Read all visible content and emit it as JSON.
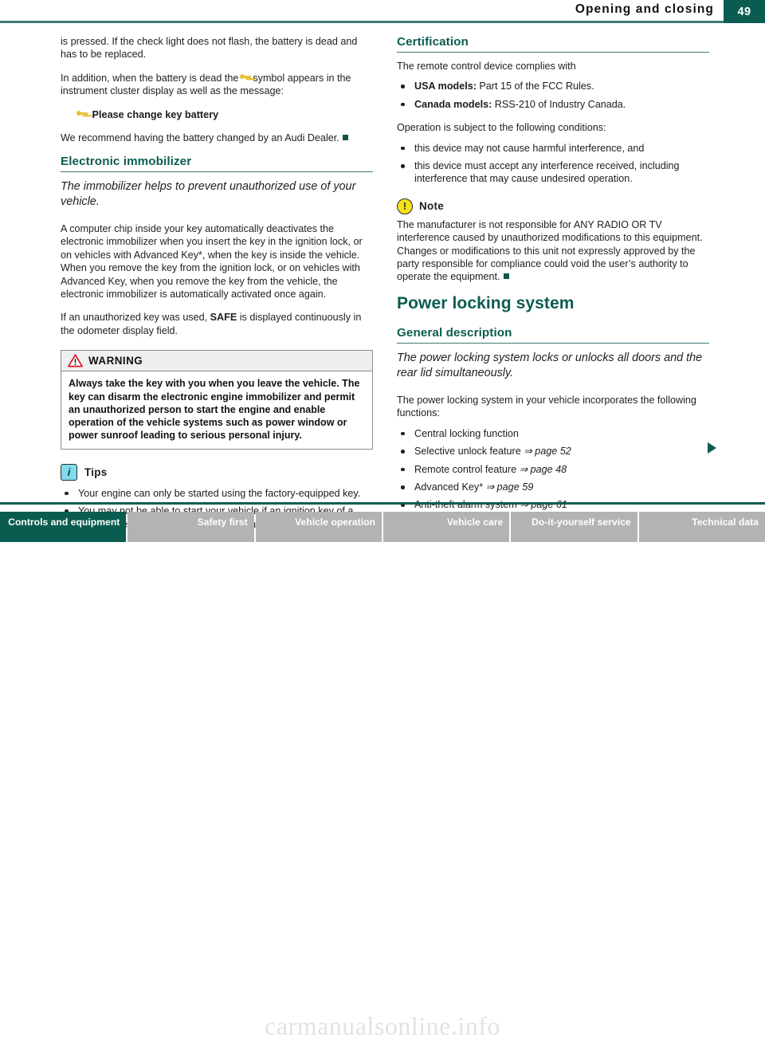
{
  "header": {
    "title": "Opening and closing",
    "page_number": "49"
  },
  "left_column": {
    "para_1": "is pressed. If the check light does not flash, the battery is dead and has to be replaced.",
    "para_2_before": "In addition, when the battery is dead the",
    "para_2_after": "symbol appears in the instrument cluster display as well as the message:",
    "message_line": "Please change key battery",
    "para_3": "We recommend having the battery changed by an Audi Dealer.",
    "section_heading": "Electronic immobilizer",
    "lead": "The immobilizer helps to prevent unauthorized use of your vehicle.",
    "para_4": "A computer chip inside your key automatically deactivates the electronic immobilizer when you insert the key in the ignition lock, or on vehicles with Advanced Key*, when the key is inside the vehicle. When you remove the key from the ignition lock, or on vehicles with Advanced Key, when you remove the key from the vehicle, the electronic immobilizer is automatically activated once again.",
    "para_5_a": "If an unauthorized key was used,",
    "para_5_bold": "SAFE",
    "para_5_b": "is displayed continuously in the odometer display field.",
    "warning": {
      "label": "WARNING",
      "body": "Always take the key with you when you leave the vehicle. The key can disarm the electronic engine immobilizer and permit an unauthorized person to start the engine and enable operation of the vehicle systems such as power window or power sunroof leading to serious personal injury."
    },
    "tips": {
      "label": "Tips",
      "icon_letter": "i",
      "items": [
        "Your engine can only be started using the factory-equipped key.",
        "You may not be able to start your vehicle if an ignition key of a different vehicle make is also located on your set of keys."
      ]
    }
  },
  "right_column": {
    "certification_heading": "Certification",
    "para_1": "The remote control device complies with",
    "compliance": [
      {
        "bold": "USA models:",
        "rest": "Part 15 of the FCC Rules."
      },
      {
        "bold": "Canada models:",
        "rest": "RSS-210 of Industry Canada."
      }
    ],
    "para_2": "Operation is subject to the following conditions:",
    "conditions": [
      "this device may not cause harmful interference, and",
      "this device must accept any interference received, including interference that may cause undesired operation."
    ],
    "note": {
      "label": "Note",
      "icon_letter": "!",
      "body": "The manufacturer is not responsible for ANY RADIO OR TV interference caused by unauthorized modifications to this equipment. Changes or modifications to this unit not expressly approved by the party responsible for compliance could void the user’s authority to operate the equipment."
    },
    "chapter_heading": "Power locking system",
    "general_heading": "General description",
    "lead": "The power locking system locks or unlocks all doors and the rear lid simultaneously.",
    "para_3": "The power locking system in your vehicle incorporates the following functions:",
    "functions": [
      {
        "label": "Central locking function",
        "ref": ""
      },
      {
        "label": "Selective unlock feature",
        "ref": "⇒ page 52"
      },
      {
        "label": "Remote control feature",
        "ref": "⇒ page 48"
      },
      {
        "label": "Advanced Key*",
        "ref": "⇒ page 59"
      },
      {
        "label": "Anti-theft alarm system",
        "ref": "⇒ page 61"
      }
    ]
  },
  "footer": {
    "tabs": [
      {
        "label": "Controls and equipment",
        "active": true
      },
      {
        "label": "Safety first",
        "active": false
      },
      {
        "label": "Vehicle operation",
        "active": false
      },
      {
        "label": "Vehicle care",
        "active": false
      },
      {
        "label": "Do-it-yourself service",
        "active": false
      },
      {
        "label": "Technical data",
        "active": false
      }
    ]
  },
  "watermark": "carmanualsonline.info",
  "colors": {
    "teal": "#0b5c50",
    "rule": "#3e7a76",
    "tab_inactive": "#b3b3b3",
    "warning_head": "#efefef",
    "note_yellow": "#f4e11a",
    "tips_cyan": "#7fdcec"
  }
}
